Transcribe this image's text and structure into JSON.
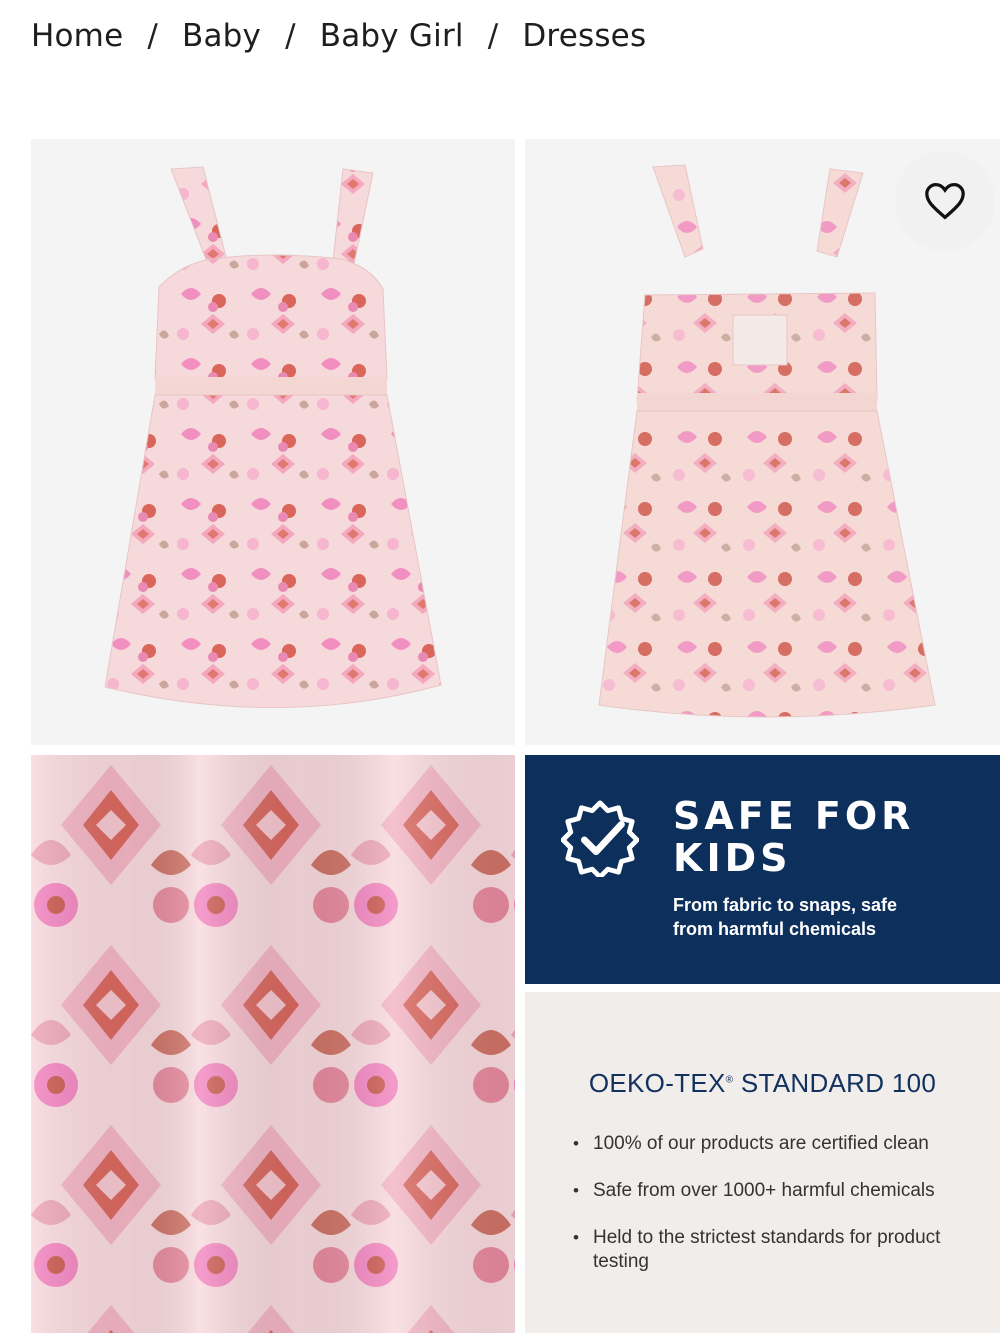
{
  "breadcrumb": {
    "items": [
      "Home",
      "Baby",
      "Baby Girl",
      "Dresses"
    ],
    "separator": "/"
  },
  "gallery": {
    "images": [
      {
        "name": "dress-front-image",
        "alt": "Floral print sleeveless dress, front view"
      },
      {
        "name": "dress-back-image",
        "alt": "Floral print sleeveless dress, back view with cutout"
      },
      {
        "name": "fabric-closeup-image",
        "alt": "Close-up of pink and red ikat floral fabric"
      }
    ],
    "favorite_icon": "heart-outline-icon"
  },
  "safe_for_kids": {
    "title_line1": "SAFE FOR",
    "title_line2": "KIDS",
    "subtitle_line1": "From fabric to snaps, safe",
    "subtitle_line2": "from harmful chemicals",
    "icon": "check-badge-icon",
    "background": "#0c2f5c"
  },
  "oeko_tex": {
    "title": "OEKO-TEX",
    "registered": "®",
    "title_suffix": " STANDARD 100",
    "bullets": [
      "100% of our products are certified clean",
      "Safe from over 1000+ harmful chemicals",
      "Held to the strictest standards for product testing"
    ],
    "title_color": "#12315f",
    "background": "#f0edea"
  }
}
